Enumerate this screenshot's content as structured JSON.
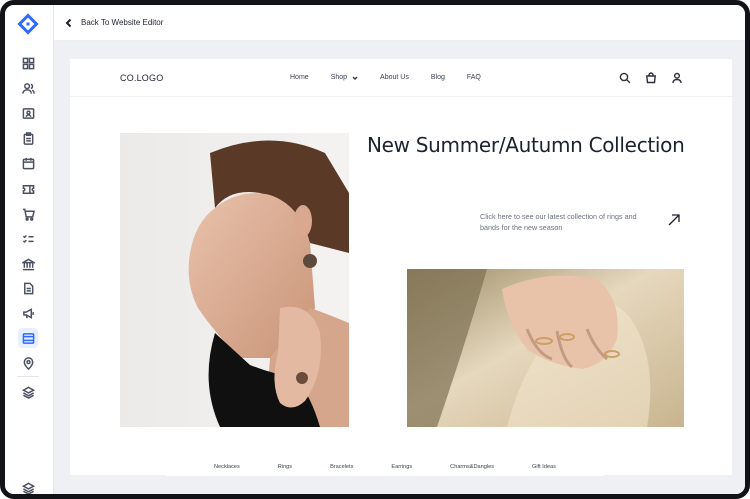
{
  "topbar": {
    "back_label": "Back To Website Editor"
  },
  "site": {
    "brand": "CO.LOGO",
    "menu": [
      "Home",
      "Shop",
      "About Us",
      "Blog",
      "FAQ"
    ],
    "hero_title": "New Summer/Autumn Collection",
    "hero_desc": "Click here to see our latest collection of rings and bands for the new season",
    "categories": [
      "Necklaces",
      "Rings",
      "Bracelets",
      "Earrings",
      "Charms&Dangles",
      "Gift Ideas"
    ]
  },
  "rail_icons": [
    "dashboard-icon",
    "users-icon",
    "contacts-icon",
    "clipboard-icon",
    "calendar-icon",
    "ticket-icon",
    "cart-icon",
    "checklist-icon",
    "bank-icon",
    "document-icon",
    "megaphone-icon",
    "website-icon",
    "location-icon",
    "layers-icon",
    "layers-bottom-icon"
  ],
  "colors": {
    "accent": "#2f6bff",
    "canvas": "#eef0f3",
    "frame": "#111318"
  }
}
